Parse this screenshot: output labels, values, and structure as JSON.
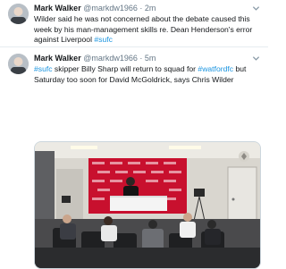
{
  "tweets": [
    {
      "author": "Mark Walker",
      "handle": "@markdw1966",
      "separator": "·",
      "time": "2m",
      "text": "Wilder said he was not concerned about the debate caused this week by his man-management skills re. Dean Henderson's error against Liverpool",
      "hashtag": "#sufc"
    },
    {
      "author": "Mark Walker",
      "handle": "@markdw1966",
      "separator": "·",
      "time": "5m",
      "hashtag_start": "#sufc",
      "text_a": " skipper Billy Sharp will return to squad for ",
      "hashtag_mid": "#watfordfc",
      "text_b": " but Saturday too soon for David McGoldrick, says Chris Wilder",
      "media": {
        "type": "photo",
        "icon": "press-conference-photo"
      }
    }
  ],
  "colors": {
    "link": "#1b95e0",
    "muted": "#657786",
    "text": "#14171a",
    "board_red": "#c8102e"
  }
}
